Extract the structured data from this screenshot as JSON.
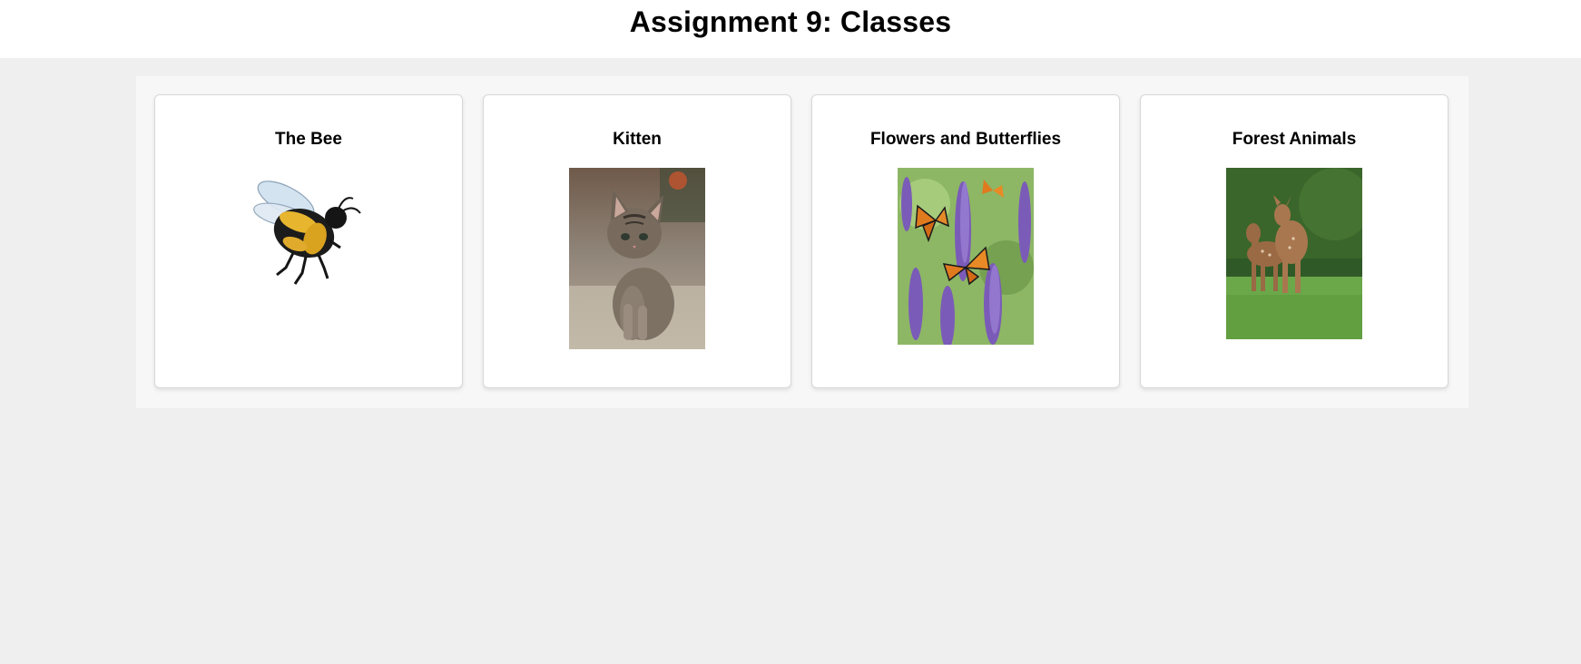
{
  "header": {
    "title": "Assignment 9: Classes"
  },
  "cards": [
    {
      "title": "The Bee",
      "image": "bee-illustration"
    },
    {
      "title": "Kitten",
      "image": "kitten-photo"
    },
    {
      "title": "Flowers and Butterflies",
      "image": "butterflies-on-lavender-photo"
    },
    {
      "title": "Forest Animals",
      "image": "fawns-in-forest-photo"
    }
  ]
}
